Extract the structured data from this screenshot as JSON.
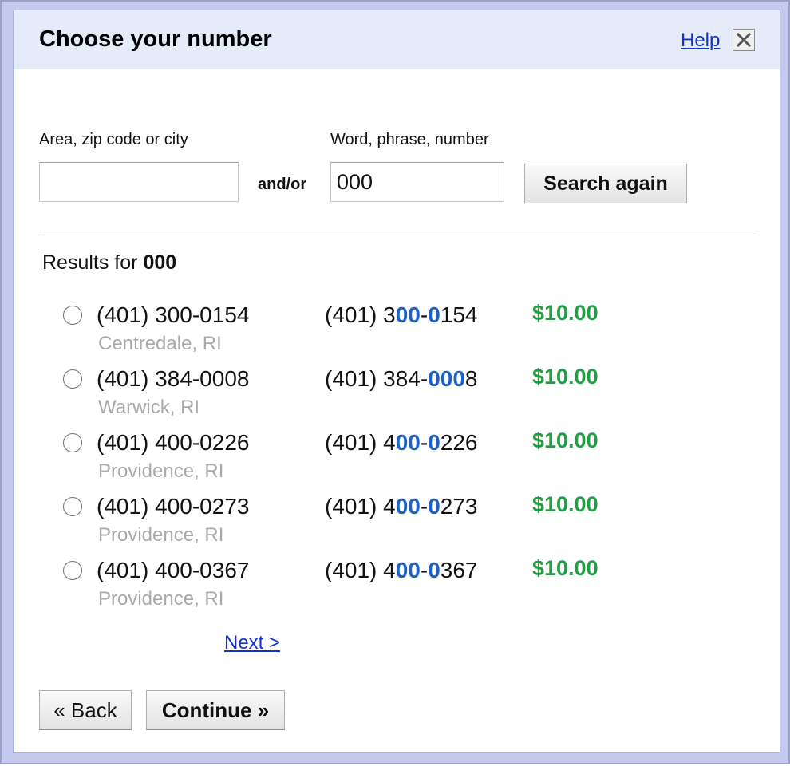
{
  "dialog": {
    "title": "Choose your number",
    "help_label": "Help"
  },
  "search": {
    "area_label": "Area, zip code or city",
    "area_value": "",
    "word_label": "Word, phrase, number",
    "word_value": "000",
    "andor_label": "and/or",
    "search_again_label": "Search again"
  },
  "results": {
    "prefix": "Results for ",
    "query": "000",
    "items": [
      {
        "number": "(401) 300-0154",
        "city": "Centredale, RI",
        "match_parts": [
          {
            "text": "(401) 3",
            "hl": false
          },
          {
            "text": "00",
            "hl": true
          },
          {
            "text": "-",
            "hl": false
          },
          {
            "text": "0",
            "hl": true
          },
          {
            "text": "154",
            "hl": false
          }
        ],
        "price": "$10.00"
      },
      {
        "number": "(401) 384-0008",
        "city": "Warwick, RI",
        "match_parts": [
          {
            "text": "(401) 384-",
            "hl": false
          },
          {
            "text": "000",
            "hl": true
          },
          {
            "text": "8",
            "hl": false
          }
        ],
        "price": "$10.00"
      },
      {
        "number": "(401) 400-0226",
        "city": "Providence, RI",
        "match_parts": [
          {
            "text": "(401) 4",
            "hl": false
          },
          {
            "text": "00",
            "hl": true
          },
          {
            "text": "-",
            "hl": false
          },
          {
            "text": "0",
            "hl": true
          },
          {
            "text": "226",
            "hl": false
          }
        ],
        "price": "$10.00"
      },
      {
        "number": "(401) 400-0273",
        "city": "Providence, RI",
        "match_parts": [
          {
            "text": "(401) 4",
            "hl": false
          },
          {
            "text": "00",
            "hl": true
          },
          {
            "text": "-",
            "hl": false
          },
          {
            "text": "0",
            "hl": true
          },
          {
            "text": "273",
            "hl": false
          }
        ],
        "price": "$10.00"
      },
      {
        "number": "(401) 400-0367",
        "city": "Providence, RI",
        "match_parts": [
          {
            "text": "(401) 4",
            "hl": false
          },
          {
            "text": "00",
            "hl": true
          },
          {
            "text": "-",
            "hl": false
          },
          {
            "text": "0",
            "hl": true
          },
          {
            "text": "367",
            "hl": false
          }
        ],
        "price": "$10.00"
      }
    ],
    "next_label": "Next >"
  },
  "footer": {
    "back_label": "« Back",
    "continue_label": "Continue »"
  },
  "colors": {
    "title_bar": "#e6ebf9",
    "link": "#1533c4",
    "match_highlight": "#1a61c9",
    "price": "#249c45",
    "city": "#a9a9a9"
  },
  "icons": {
    "close": "close-icon"
  }
}
